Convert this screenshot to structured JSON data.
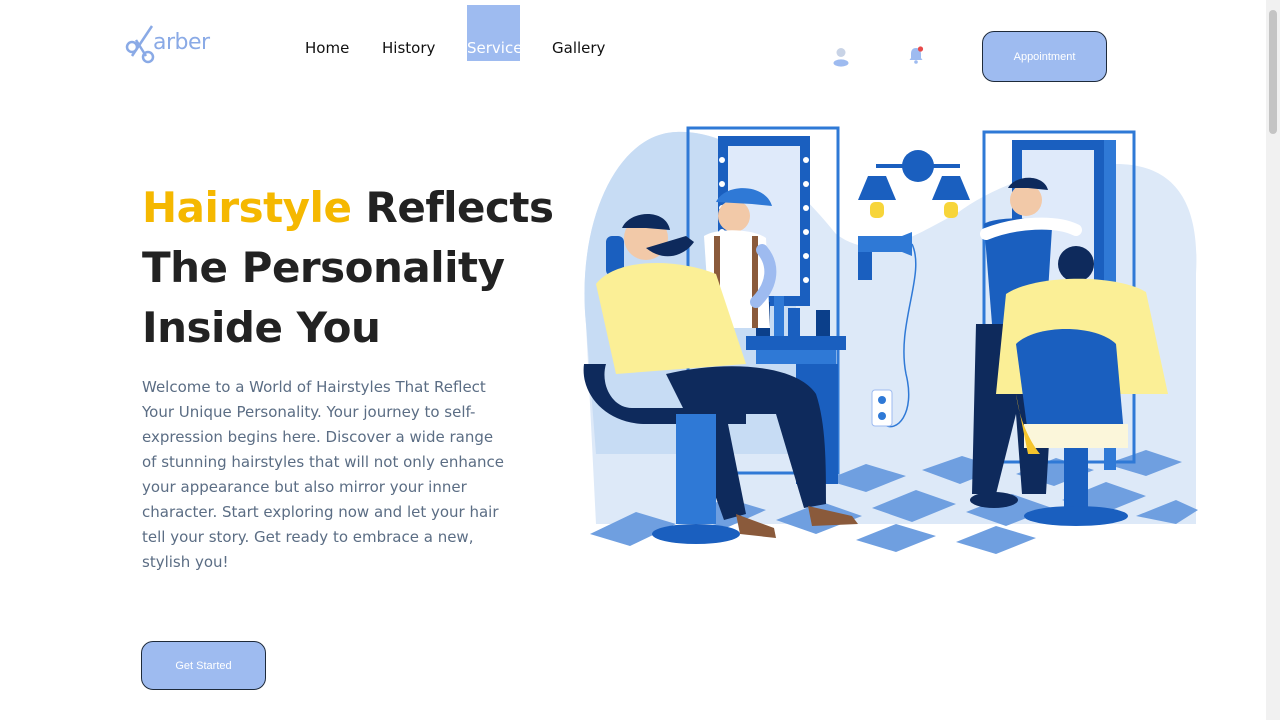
{
  "brand": {
    "logo_text": "arber",
    "accent": "#9ebbf0",
    "highlight": "#f5b800"
  },
  "nav": {
    "items": [
      {
        "label": "Home",
        "active": false
      },
      {
        "label": "History",
        "active": false
      },
      {
        "label": "Service",
        "active": true
      },
      {
        "label": "Gallery",
        "active": false
      }
    ]
  },
  "header": {
    "user_icon": "user-icon",
    "bell_icon": "bell-icon",
    "appointment_label": "Appointment"
  },
  "hero": {
    "title_highlight": "Hairstyle",
    "title_rest_1": " Reflects",
    "title_line_2": "The Personality",
    "title_line_3": "Inside You",
    "description": "Welcome to a World of Hairstyles That Reflect Your Unique Personality. Your journey to self-expression begins here. Discover a wide range of stunning hairstyles that will not only enhance your appearance but also mirror your inner character. Start exploring now and let your hair tell your story. Get ready to embrace a new, stylish you!",
    "cta_label": "Get Started"
  }
}
